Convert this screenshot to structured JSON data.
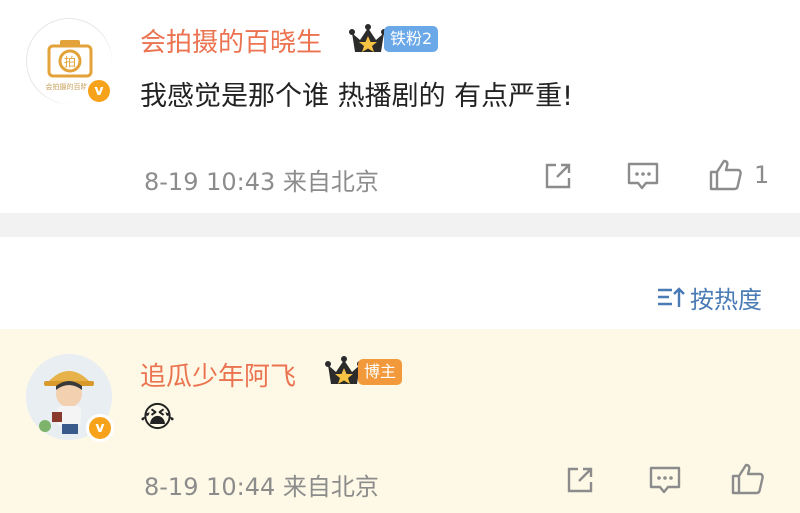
{
  "comments": [
    {
      "username": "会拍摄的百晓生",
      "badge": "铁粉2",
      "text": "我感觉是那个谁 热播剧的 有点严重!",
      "meta": "8-19 10:43 来自北京",
      "like_count": "1",
      "avatar_icon": "camera-logo",
      "verified_icon": "v"
    },
    {
      "username": "追瓜少年阿飞",
      "badge": "博主",
      "emoji": "😭",
      "meta": "8-19 10:44 来自北京",
      "avatar_icon": "cartoon-boy",
      "verified_icon": "v"
    }
  ],
  "sort": {
    "label": "按热度"
  },
  "colors": {
    "username": "#eb7350",
    "badge_fan": "#6aa8e8",
    "badge_blogger": "#f2993b",
    "highlight_bg": "#fdf9e6",
    "meta": "#8c8c8c",
    "link": "#4a7bb5"
  }
}
